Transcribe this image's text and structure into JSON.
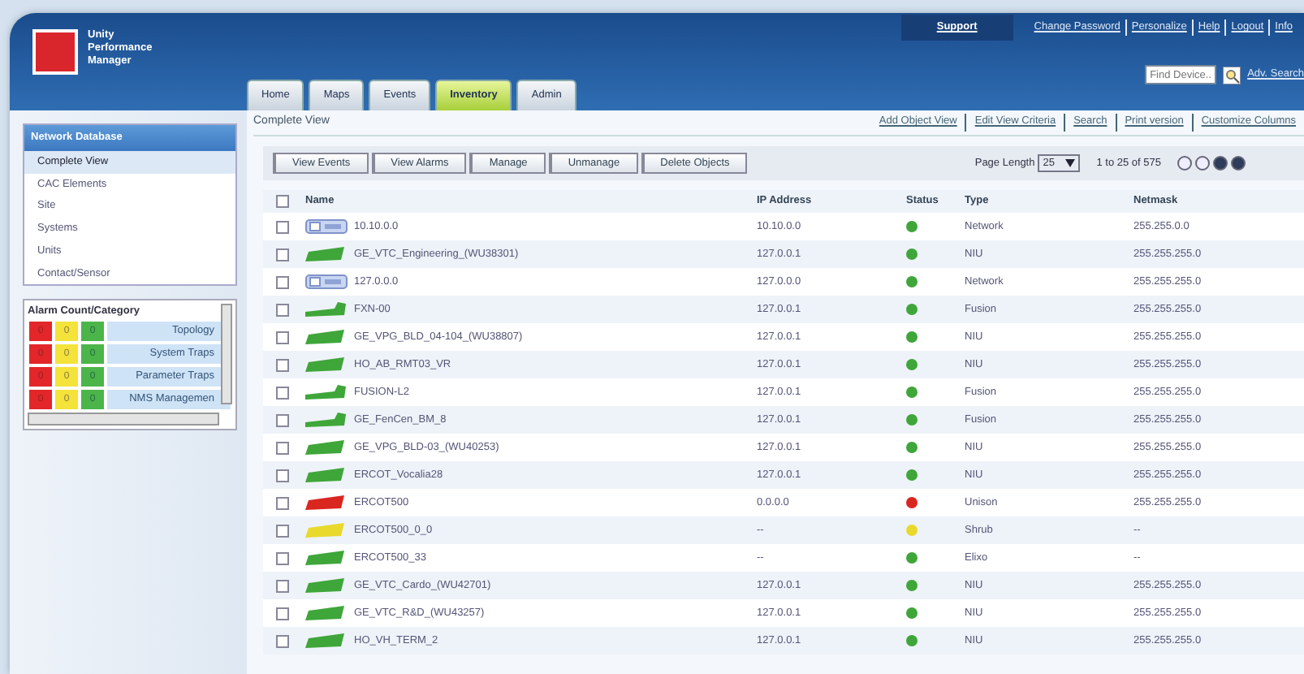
{
  "logo": {
    "lines": [
      "Unity",
      "Performance",
      "Manager"
    ]
  },
  "header_links": {
    "support": "Support",
    "links": [
      "Change Password",
      "Personalize",
      "Help",
      "Logout",
      "Info"
    ]
  },
  "search": {
    "placeholder": "Find Device...",
    "advanced": "Adv. Search"
  },
  "tabs": [
    {
      "label": "Home",
      "selected": false
    },
    {
      "label": "Maps",
      "selected": false
    },
    {
      "label": "Events",
      "selected": false
    },
    {
      "label": "Inventory",
      "selected": true
    },
    {
      "label": "Admin",
      "selected": false
    }
  ],
  "sidebar": {
    "title": "Network Database",
    "items": [
      {
        "label": "Complete View",
        "selected": true
      },
      {
        "label": "CAC Elements",
        "selected": false
      },
      {
        "label": "Site",
        "selected": false
      },
      {
        "label": "Systems",
        "selected": false
      },
      {
        "label": "Units",
        "selected": false
      },
      {
        "label": "Contact/Sensor",
        "selected": false
      }
    ]
  },
  "alarm_panel": {
    "title": "Alarm Count/Category",
    "rows": [
      {
        "critical": "0",
        "major": "0",
        "minor": "0",
        "category": "Topology"
      },
      {
        "critical": "0",
        "major": "0",
        "minor": "0",
        "category": "System Traps"
      },
      {
        "critical": "0",
        "major": "0",
        "minor": "0",
        "category": "Parameter Traps"
      },
      {
        "critical": "0",
        "major": "0",
        "minor": "0",
        "category": "NMS Managemen"
      }
    ]
  },
  "breadcrumb": "Complete View",
  "view_links": [
    "Add Object View",
    "Edit View Criteria",
    "Search",
    "Print version",
    "Customize Columns"
  ],
  "actions": [
    "View Events",
    "View Alarms",
    "Manage",
    "Unmanage",
    "Delete Objects"
  ],
  "paging": {
    "label": "Page Length",
    "value": "25",
    "range": "1 to 25 of 575"
  },
  "table": {
    "select_all_checked": false,
    "columns": [
      "Name",
      "IP Address",
      "Status",
      "Type",
      "Netmask"
    ],
    "rows": [
      {
        "kind": "network",
        "name": "10.10.0.0",
        "ip": "10.10.0.0",
        "color": "#3fa63a",
        "type": "Network",
        "netmask": "255.255.0.0",
        "checked": false
      },
      {
        "kind": "device",
        "name": "GE_VTC_Engineering_(WU38301)",
        "ip": "127.0.0.1",
        "color": "#3fa63a",
        "type": "NIU",
        "netmask": "255.255.255.0",
        "checked": false
      },
      {
        "kind": "network",
        "name": "127.0.0.0",
        "ip": "127.0.0.0",
        "color": "#3fa63a",
        "type": "Network",
        "netmask": "255.255.255.0",
        "checked": false
      },
      {
        "kind": "fusion",
        "name": "FXN-00",
        "ip": "127.0.0.1",
        "color": "#3fa63a",
        "type": "Fusion",
        "netmask": "255.255.255.0",
        "checked": false
      },
      {
        "kind": "device",
        "name": "GE_VPG_BLD_04-104_(WU38807)",
        "ip": "127.0.0.1",
        "color": "#3fa63a",
        "type": "NIU",
        "netmask": "255.255.255.0",
        "checked": false
      },
      {
        "kind": "device",
        "name": "HO_AB_RMT03_VR",
        "ip": "127.0.0.1",
        "color": "#3fa63a",
        "type": "NIU",
        "netmask": "255.255.255.0",
        "checked": false
      },
      {
        "kind": "fusion",
        "name": "FUSION-L2",
        "ip": "127.0.0.1",
        "color": "#3fa63a",
        "type": "Fusion",
        "netmask": "255.255.255.0",
        "checked": false
      },
      {
        "kind": "fusion",
        "name": "GE_FenCen_BM_8",
        "ip": "127.0.0.1",
        "color": "#3fa63a",
        "type": "Fusion",
        "netmask": "255.255.255.0",
        "checked": false
      },
      {
        "kind": "device",
        "name": "GE_VPG_BLD-03_(WU40253)",
        "ip": "127.0.0.1",
        "color": "#3fa63a",
        "type": "NIU",
        "netmask": "255.255.255.0",
        "checked": false
      },
      {
        "kind": "device",
        "name": "ERCOT_Vocalia28",
        "ip": "127.0.0.1",
        "color": "#3fa63a",
        "type": "NIU",
        "netmask": "255.255.255.0",
        "checked": false
      },
      {
        "kind": "device",
        "name": "ERCOT500",
        "ip": "0.0.0.0",
        "color": "#d9261f",
        "type": "Unison",
        "netmask": "255.255.255.0",
        "checked": false
      },
      {
        "kind": "device",
        "name": "ERCOT500_0_0",
        "ip": "--",
        "color": "#e9d92c",
        "type": "Shrub",
        "netmask": "--",
        "checked": false
      },
      {
        "kind": "device",
        "name": "ERCOT500_33",
        "ip": "--",
        "color": "#3fa63a",
        "type": "Elixo",
        "netmask": "--",
        "checked": false
      },
      {
        "kind": "device",
        "name": "GE_VTC_Cardo_(WU42701)",
        "ip": "127.0.0.1",
        "color": "#3fa63a",
        "type": "NIU",
        "netmask": "255.255.255.0",
        "checked": false
      },
      {
        "kind": "device",
        "name": "GE_VTC_R&D_(WU43257)",
        "ip": "127.0.0.1",
        "color": "#3fa63a",
        "type": "NIU",
        "netmask": "255.255.255.0",
        "checked": false
      },
      {
        "kind": "device",
        "name": "HO_VH_TERM_2",
        "ip": "127.0.0.1",
        "color": "#3fa63a",
        "type": "NIU",
        "netmask": "255.255.255.0",
        "checked": false
      }
    ]
  }
}
